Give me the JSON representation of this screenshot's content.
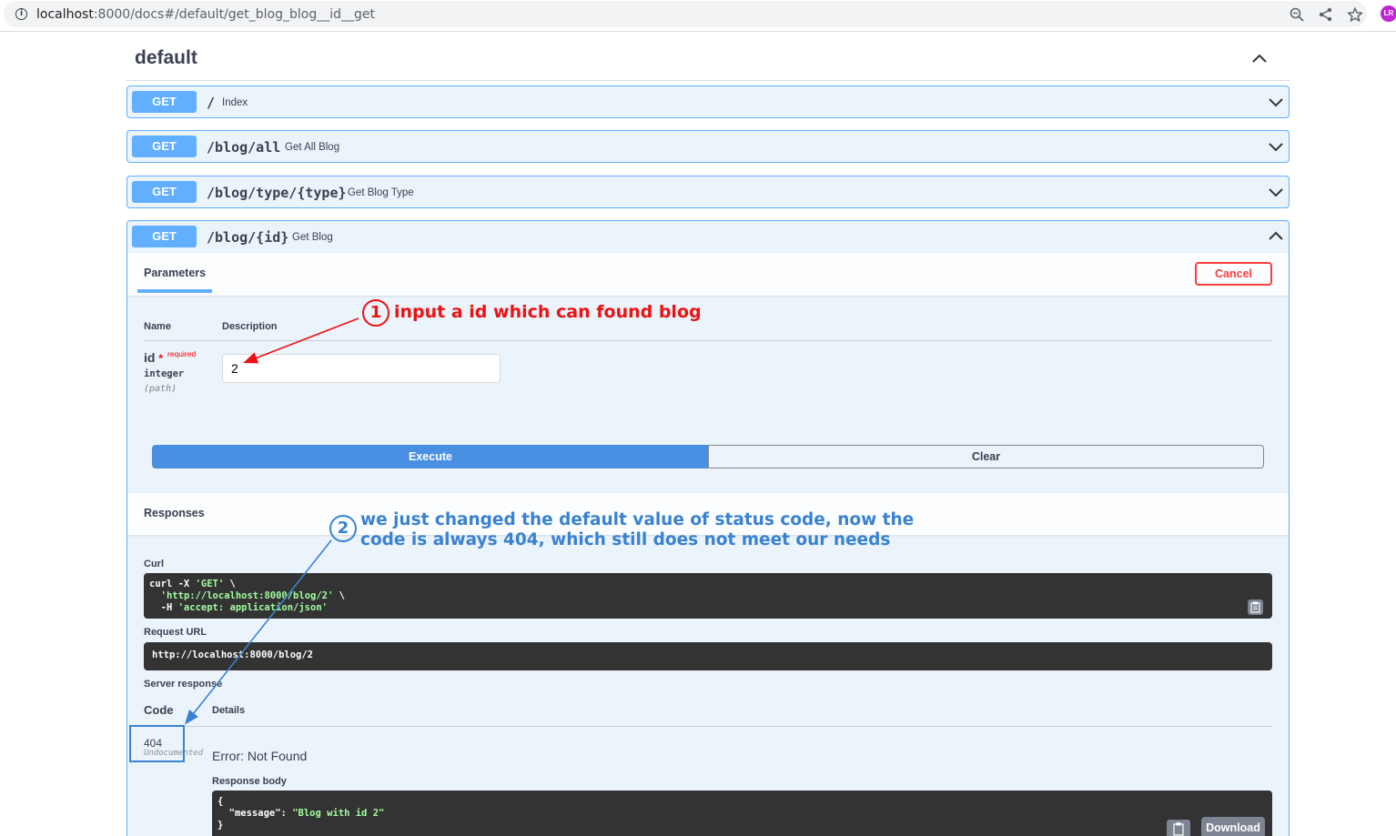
{
  "browser": {
    "url_host": "localhost",
    "url_path": ":8000/docs#/default/get_blog_blog__id__get",
    "icons": [
      "info-icon",
      "zoom-icon",
      "share-icon",
      "star-icon",
      "profile-icon"
    ]
  },
  "tag": {
    "title": "default"
  },
  "operations": [
    {
      "method": "GET",
      "path": "/",
      "summary": "Index"
    },
    {
      "method": "GET",
      "path": "/blog/all",
      "summary": "Get All Blog"
    },
    {
      "method": "GET",
      "path": "/blog/type/{type}",
      "summary": "Get Blog Type"
    },
    {
      "method": "GET",
      "path": "/blog/{id}",
      "summary": "Get Blog"
    }
  ],
  "params": {
    "tab_label": "Parameters",
    "cancel_label": "Cancel",
    "col_name": "Name",
    "col_description": "Description",
    "param_name": "id",
    "param_star": "*",
    "param_required": "required",
    "param_type": "integer",
    "param_in": "(path)",
    "param_value": "2"
  },
  "actions": {
    "execute_label": "Execute",
    "clear_label": "Clear"
  },
  "responses": {
    "title": "Responses",
    "curl_label": "Curl",
    "curl_cmd": "curl -X ",
    "curl_method": "'GET'",
    "curl_cont": " \\",
    "curl_url": "'http://localhost:8000/blog/2'",
    "curl_header_flag": "  -H ",
    "curl_header": "'accept: application/json'",
    "request_url_label": "Request URL",
    "request_url": "http://localhost:8000/blog/2",
    "server_response_label": "Server response",
    "code_col": "Code",
    "details_col": "Details",
    "status_code": "404",
    "undocumented": "Undocumented",
    "error": "Error: Not Found",
    "body_label": "Response body",
    "body_open": "{",
    "body_key": "  \"message\": ",
    "body_value": "\"Blog with id 2\"",
    "body_close": "}",
    "download_label": "Download"
  },
  "annotations": {
    "step1_num": "1",
    "step1_text": "input a id which can found blog",
    "step2_num": "2",
    "step2_line1": "we just changed the default value of status code, now the",
    "step2_line2": "code is always 404, which still does not meet our needs",
    "color_red": "#ee1111",
    "color_blue": "#3a82d0"
  },
  "colors": {
    "get_method": "#61affe",
    "execute": "#4990e2",
    "cancel": "#f93e3e"
  }
}
